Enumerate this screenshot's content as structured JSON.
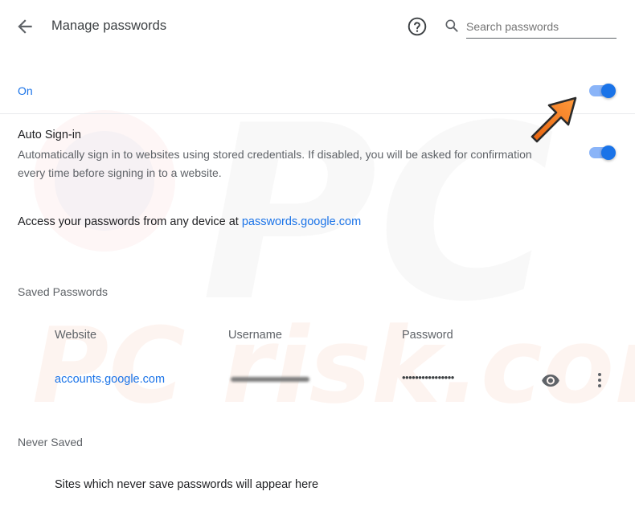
{
  "header": {
    "title": "Manage passwords",
    "back_icon": "arrow-left-icon",
    "help_icon": "help-circle-icon",
    "search": {
      "icon": "search-icon",
      "placeholder": "Search passwords",
      "value": ""
    }
  },
  "save_passwords": {
    "label": "On",
    "enabled": true
  },
  "auto_signin": {
    "title": "Auto Sign-in",
    "description": "Automatically sign in to websites using stored credentials. If disabled, you will be asked for confirmation every time before signing in to a website.",
    "enabled": true
  },
  "access": {
    "text": "Access your passwords from any device at ",
    "link": "passwords.google.com"
  },
  "saved_passwords": {
    "heading": "Saved Passwords",
    "columns": {
      "website": "Website",
      "username": "Username",
      "password": "Password"
    },
    "rows": [
      {
        "website": "accounts.google.com",
        "password_mask": "••••••••••••••••",
        "eye_icon": "eye-icon",
        "more_icon": "more-vertical-icon"
      }
    ]
  },
  "never_saved": {
    "heading": "Never Saved",
    "empty_text": "Sites which never save passwords will appear here"
  },
  "watermark": {
    "text": "PC risk.com"
  },
  "colors": {
    "accent": "#1a73e8",
    "toggle_track": "#8ab4f8",
    "arrow": "#f47c20"
  }
}
